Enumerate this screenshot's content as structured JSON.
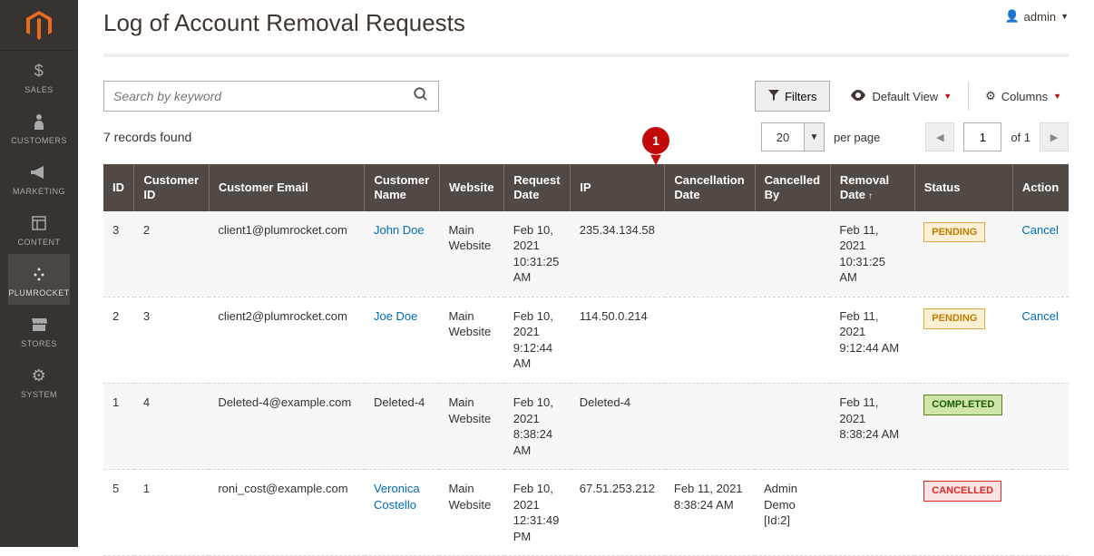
{
  "sidebar": {
    "items": [
      {
        "label": "SALES",
        "icon": "$"
      },
      {
        "label": "CUSTOMERS",
        "icon": "person"
      },
      {
        "label": "MARKETING",
        "icon": "megaphone"
      },
      {
        "label": "CONTENT",
        "icon": "layout"
      },
      {
        "label": "PLUMROCKET",
        "icon": "dots"
      },
      {
        "label": "STORES",
        "icon": "store"
      },
      {
        "label": "SYSTEM",
        "icon": "gear"
      }
    ]
  },
  "header": {
    "title": "Log of Account Removal Requests",
    "admin": "admin"
  },
  "search": {
    "placeholder": "Search by keyword"
  },
  "toolbar": {
    "filters": "Filters",
    "default_view": "Default View",
    "columns": "Columns"
  },
  "paging": {
    "records_found": "7 records found",
    "page_size": "20",
    "per_page": "per page",
    "page": "1",
    "of": "of 1"
  },
  "columns": [
    "ID",
    "Customer ID",
    "Customer Email",
    "Customer Name",
    "Website",
    "Request Date",
    "IP",
    "Cancellation Date",
    "Cancelled By",
    "Removal Date",
    "Status",
    "Action"
  ],
  "sort_col": "Removal Date",
  "rows": [
    {
      "id": "3",
      "cust_id": "2",
      "email": "client1@plumrocket.com",
      "name": "John Doe",
      "name_link": true,
      "website": "Main Website",
      "request_date": "Feb 10, 2021 10:31:25 AM",
      "ip": "235.34.134.58",
      "cancel_date": "",
      "cancel_by": "",
      "removal_date": "Feb 11, 2021 10:31:25 AM",
      "status": "PENDING",
      "action": "Cancel"
    },
    {
      "id": "2",
      "cust_id": "3",
      "email": "client2@plumrocket.com",
      "name": "Joe Doe",
      "name_link": true,
      "website": "Main Website",
      "request_date": "Feb 10, 2021 9:12:44 AM",
      "ip": "114.50.0.214",
      "cancel_date": "",
      "cancel_by": "",
      "removal_date": "Feb 11, 2021 9:12:44 AM",
      "status": "PENDING",
      "action": "Cancel"
    },
    {
      "id": "1",
      "cust_id": "4",
      "email": "Deleted-4@example.com",
      "name": "Deleted-4",
      "name_link": false,
      "website": "Main Website",
      "request_date": "Feb 10, 2021 8:38:24 AM",
      "ip": "Deleted-4",
      "cancel_date": "",
      "cancel_by": "",
      "removal_date": "Feb 11, 2021 8:38:24 AM",
      "status": "COMPLETED",
      "action": ""
    },
    {
      "id": "5",
      "cust_id": "1",
      "email": "roni_cost@example.com",
      "name": "Veronica Costello",
      "name_link": true,
      "website": "Main Website",
      "request_date": "Feb 10, 2021 12:31:49 PM",
      "ip": "67.51.253.212",
      "cancel_date": "Feb 11, 2021 8:38:24 AM",
      "cancel_by": "Admin Demo [Id:2]",
      "removal_date": "",
      "status": "CANCELLED",
      "action": ""
    }
  ],
  "marker": {
    "num": "1"
  }
}
